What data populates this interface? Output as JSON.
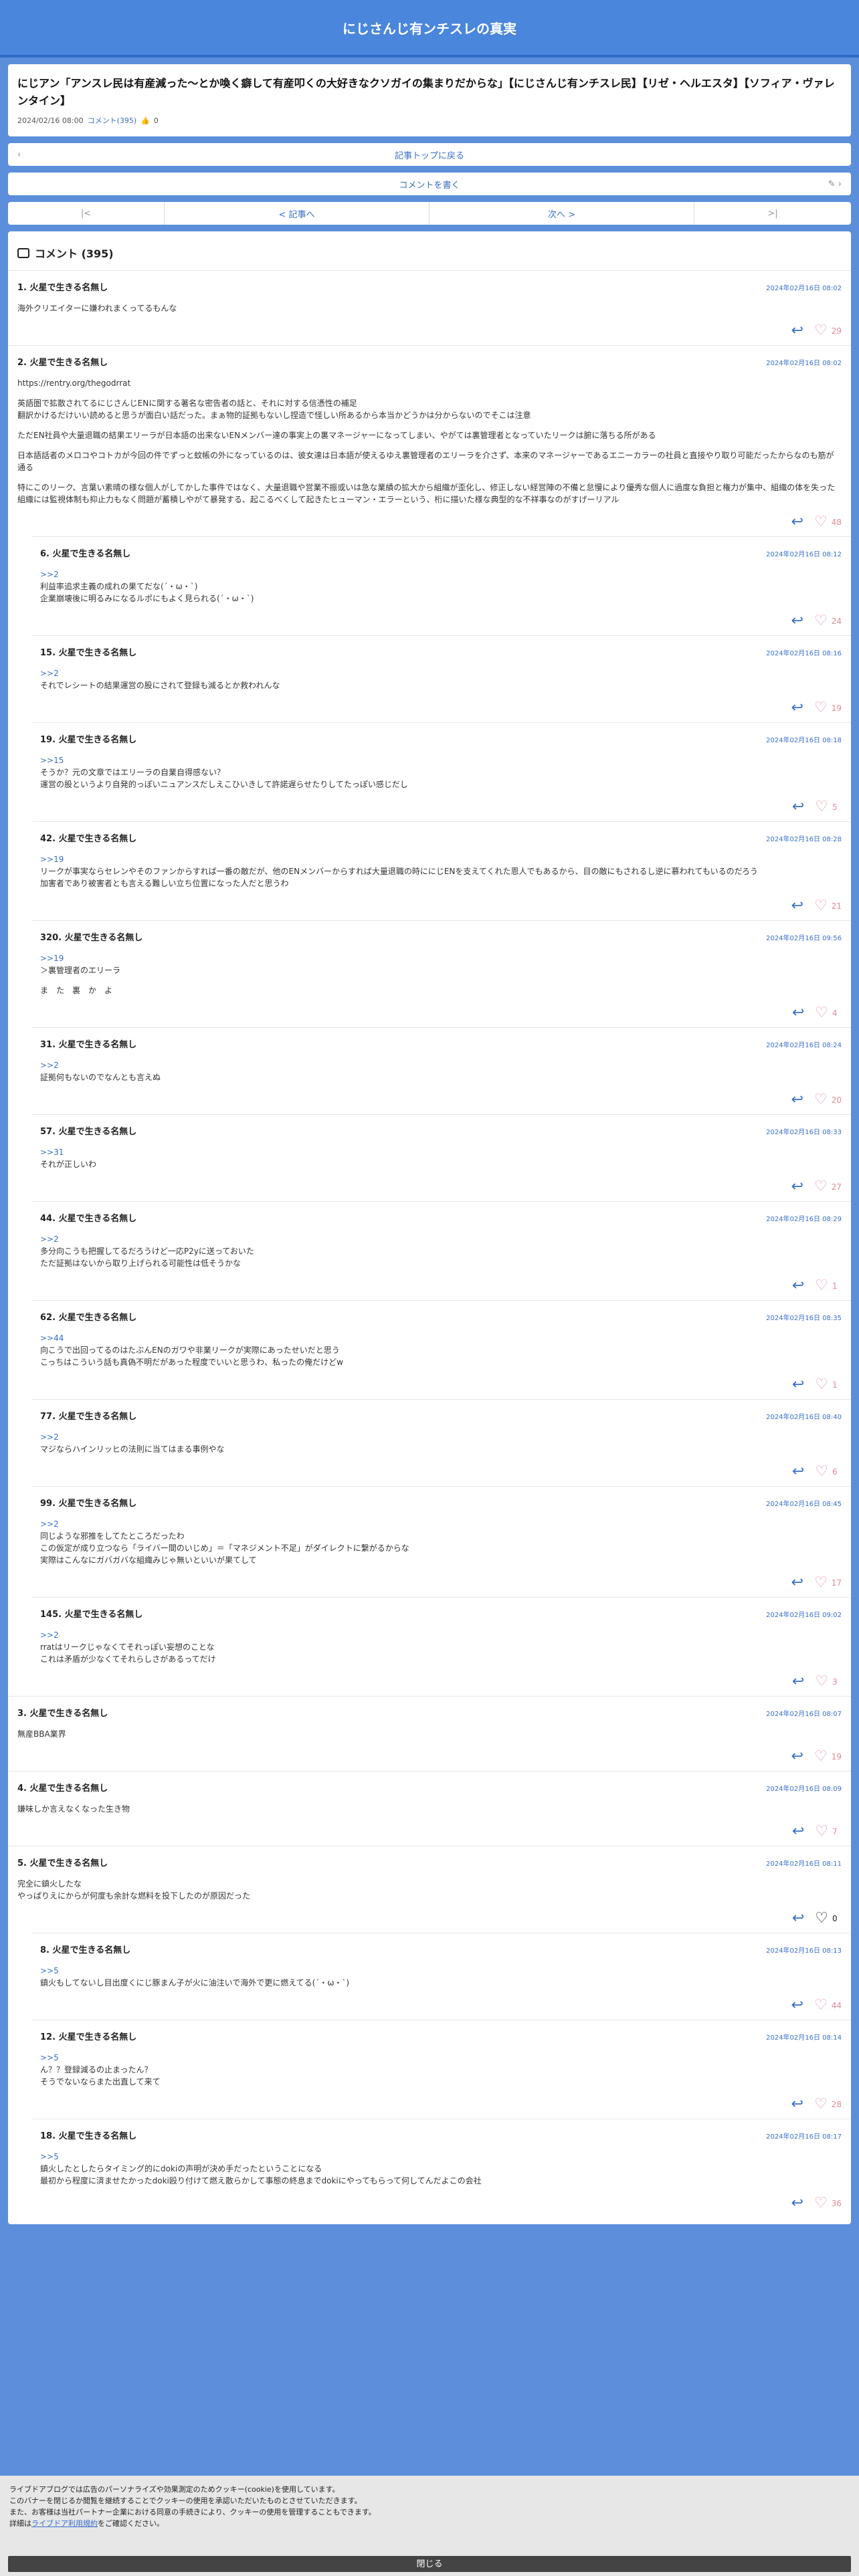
{
  "site_title": "にじさんじ有ンチスレの真実",
  "article": {
    "title": "にじアン「アンスレ民は有産減った～とか喚く癖して有産叩くの大好きなクソガイの集まりだからな」【にじさんじ有ンチスレ民】【リゼ・ヘルエスタ】【ソフィア・ヴァレンタイン】",
    "date": "2024/02/16 08:00",
    "comments_link": "コメント(395)",
    "likes": "0"
  },
  "nav": {
    "top_label": "記事トップに戻る",
    "write_label": "コメントを書く",
    "first": "|<",
    "prev": "< 記事へ",
    "next": "次へ >",
    "last": ">|"
  },
  "comments_header": "コメント (395)",
  "comments": [
    {
      "no": "1.",
      "name": "火星で生きる名無し",
      "date": "2024年02月16日 08:02",
      "lines": [
        "海外クリエイターに嫌われまくってるもんな"
      ],
      "likes": "29",
      "reply": false
    },
    {
      "no": "2.",
      "name": "火星で生きる名無し",
      "date": "2024年02月16日 08:02",
      "lines": [
        "https://rentry.org/thegodrrat",
        "",
        "英語圏で拡散されてるにじさんじENに関する著名な密告者の話と、それに対する信憑性の補足",
        "翻訳かけるだけいい読めると思うが面白い話だった。まぁ物的証拠もないし捏造で怪しい所あるから本当かどうかは分からないのでそこは注意",
        "",
        "ただEN社員や大量退職の結果エリーラが日本語の出来ないENメンバー達の事実上の裏マネージャーになってしまい、やがては裏管理者となっていたリークは腑に落ちる所がある",
        "",
        "日本語話者のメロコやコトカが今回の件でずっと蚊帳の外になっているのは、彼女達は日本語が使えるゆえ裏管理者のエリーラを介さず、本来のマネージャーであるエニーカラーの社員と直接やり取り可能だったからなのも筋が通る",
        "",
        "特にこのリーク、言葉い素晴の様な個人がしてかした事件ではなく、大量退職や営業不振或いは急な業績の拡大から組織が歪化し、修正しない経営陣の不備と怠慢により優秀な個人に過度な負担と権力が集中、組織の体を失った組織には監視体制も抑止力もなく問題が蓄積しやがて暴発する、起こるべくして起きたヒューマン・エラーという、桁に描いた様な典型的な不祥事なのがすげーリアル"
      ],
      "likes": "48",
      "reply": false
    },
    {
      "no": "6.",
      "name": "火星で生きる名無し",
      "date": "2024年02月16日 08:12",
      "lines": [
        ">>2",
        "利益率追求主義の成れの果てだな(´・ω・`)",
        "企業崩壊後に明るみになるルポにもよく見られる(´・ω・`)"
      ],
      "likes": "24",
      "reply": true
    },
    {
      "no": "15.",
      "name": "火星で生きる名無し",
      "date": "2024年02月16日 08:16",
      "lines": [
        ">>2",
        "それでレシートの結果運営の股にされて登録も減るとか救われんな"
      ],
      "likes": "19",
      "reply": true
    },
    {
      "no": "19.",
      "name": "火星で生きる名無し",
      "date": "2024年02月16日 08:18",
      "lines": [
        ">>15",
        "そうか？元の文章ではエリーラの自業自得感ない？",
        "運営の股というより自発的っぽいニュアンスだしえこひいきして許諾遅らせたりしてたっぽい感じだし"
      ],
      "likes": "5",
      "reply": true
    },
    {
      "no": "42.",
      "name": "火星で生きる名無し",
      "date": "2024年02月16日 08:28",
      "lines": [
        ">>19",
        "リークが事実ならセレンやそのファンからすれば一番の敵だが、他のENメンバーからすれば大量退職の時ににじENを支えてくれた恩人でもあるから、目の敵にもされるし逆に慕われてもいるのだろう",
        "加害者であり被害者とも言える難しい立ち位置になった人だと思うわ"
      ],
      "likes": "21",
      "reply": true
    },
    {
      "no": "320.",
      "name": "火星で生きる名無し",
      "date": "2024年02月16日 09:56",
      "lines": [
        ">>19",
        "＞裏管理者のエリーラ",
        "",
        "ま　た　裏　か　よ"
      ],
      "likes": "4",
      "reply": true
    },
    {
      "no": "31.",
      "name": "火星で生きる名無し",
      "date": "2024年02月16日 08:24",
      "lines": [
        ">>2",
        "証拠何もないのでなんとも言えぬ"
      ],
      "likes": "20",
      "reply": true
    },
    {
      "no": "57.",
      "name": "火星で生きる名無し",
      "date": "2024年02月16日 08:33",
      "lines": [
        ">>31",
        "それが正しいわ"
      ],
      "likes": "27",
      "reply": true
    },
    {
      "no": "44.",
      "name": "火星で生きる名無し",
      "date": "2024年02月16日 08:29",
      "lines": [
        ">>2",
        "多分向こうも把握してるだろうけど一応P2yに送っておいた",
        "ただ証拠はないから取り上げられる可能性は低そうかな"
      ],
      "likes": "1",
      "reply": true
    },
    {
      "no": "62.",
      "name": "火星で生きる名無し",
      "date": "2024年02月16日 08:35",
      "lines": [
        ">>44",
        "向こうで出回ってるのはたぶんENのガワや非業リークが実際にあったせいだと思う",
        "こっちはこういう話も真偽不明だがあった程度でいいと思うわ、私ったの俺だけどw"
      ],
      "likes": "1",
      "reply": true
    },
    {
      "no": "77.",
      "name": "火星で生きる名無し",
      "date": "2024年02月16日 08:40",
      "lines": [
        ">>2",
        "マジならハインリッヒの法則に当てはまる事例やな"
      ],
      "likes": "6",
      "reply": true
    },
    {
      "no": "99.",
      "name": "火星で生きる名無し",
      "date": "2024年02月16日 08:45",
      "lines": [
        ">>2",
        "同じような邪推をしてたところだったわ",
        "この仮定が成り立つなら「ライバー間のいじめ」＝「マネジメント不足」がダイレクトに繋がるからな",
        "実際はこんなにガバガバな組織みじゃ無いといいが果てして"
      ],
      "likes": "17",
      "reply": true
    },
    {
      "no": "145.",
      "name": "火星で生きる名無し",
      "date": "2024年02月16日 09:02",
      "lines": [
        ">>2",
        "rratはリークじゃなくてそれっぽい妄想のことな",
        "これは矛盾が少なくてそれらしさがあるってだけ"
      ],
      "likes": "3",
      "reply": true
    },
    {
      "no": "3.",
      "name": "火星で生きる名無し",
      "date": "2024年02月16日 08:07",
      "lines": [
        "無産BBA業界"
      ],
      "likes": "19",
      "reply": false
    },
    {
      "no": "4.",
      "name": "火星で生きる名無し",
      "date": "2024年02月16日 08:09",
      "lines": [
        "嫌味しか言えなくなった生き物"
      ],
      "likes": "7",
      "reply": false
    },
    {
      "no": "5.",
      "name": "火星で生きる名無し",
      "date": "2024年02月16日 08:11",
      "lines": [
        "完全に鎮火したな",
        "やっぱりえにからが何度も余計な燃料を投下したのが原因だった"
      ],
      "likes": "0",
      "reply": false
    },
    {
      "no": "8.",
      "name": "火星で生きる名無し",
      "date": "2024年02月16日 08:13",
      "lines": [
        ">>5",
        "鎮火もしてないし目出度くにじ豚まん子が火に油注いで海外で更に燃えてる(´・ω・`)"
      ],
      "likes": "44",
      "reply": true
    },
    {
      "no": "12.",
      "name": "火星で生きる名無し",
      "date": "2024年02月16日 08:14",
      "lines": [
        ">>5",
        "ん？？登録減るの止まったん？",
        "そうでないならまた出直して来て"
      ],
      "likes": "28",
      "reply": true
    },
    {
      "no": "18.",
      "name": "火星で生きる名無し",
      "date": "2024年02月16日 08:17",
      "lines": [
        ">>5",
        "鎮火したとしたらタイミング的にdokiの声明が決め手だったということになる",
        "最初から程度に済ませたかったdoki殴り付けて燃え散らかして事態の終息までdokiにやってもらって何してんだよこの会社"
      ],
      "likes": "36",
      "reply": true
    }
  ],
  "cookie": {
    "line1": "ライブドアブログでは広告のパーソナライズや効果測定のためクッキー(cookie)を使用しています。",
    "line2": "このバナーを閉じるか閲覧を継続することでクッキーの使用を承認いただいたものとさせていただきます。",
    "line3": "また、お客様は当社パートナー企業における同意の手続きにより、クッキーの使用を管理することもできます。",
    "line4_pre": "詳細は",
    "line4_link": "ライブドア利用規約",
    "line4_post": "をご確認ください。",
    "close_label": "閉じる"
  }
}
